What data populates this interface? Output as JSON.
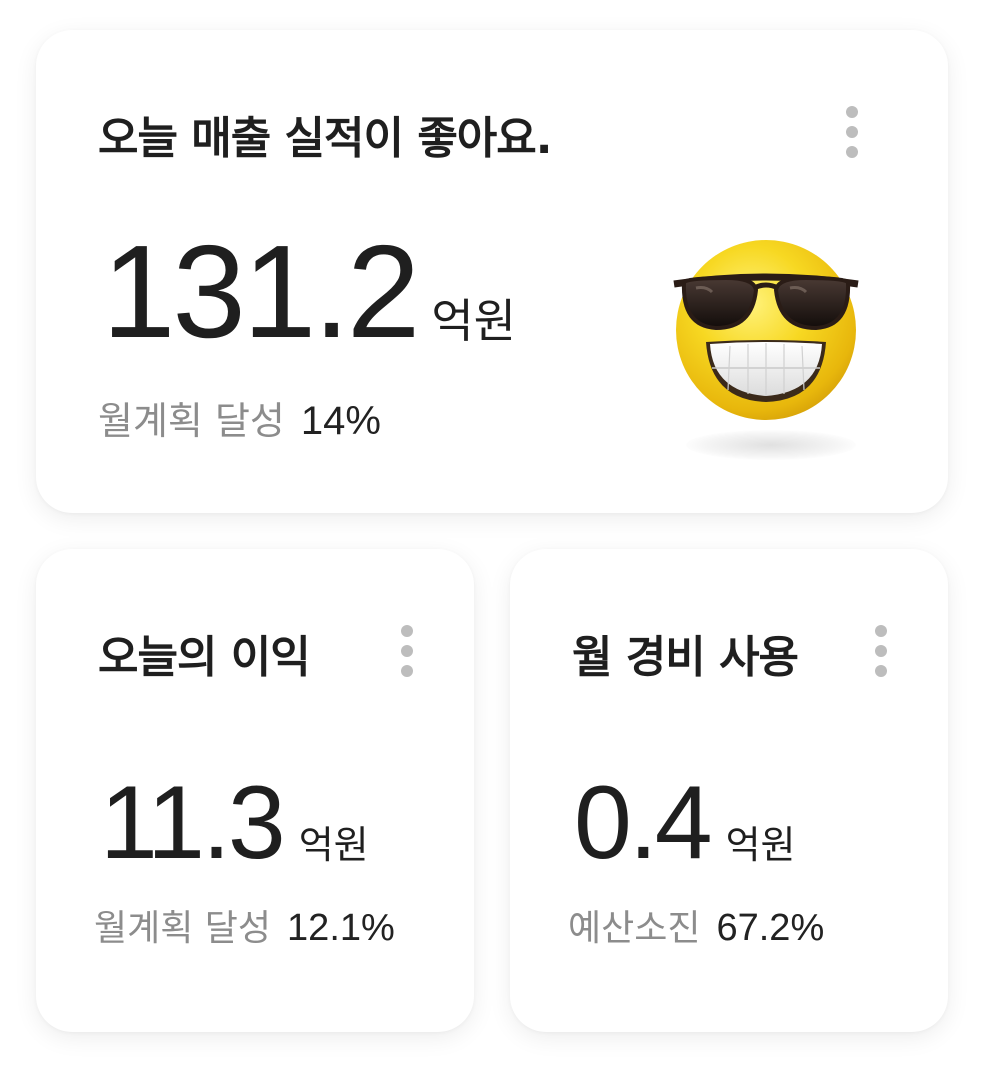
{
  "sales_card": {
    "title": "오늘 매출 실적이 좋아요.",
    "value": "131.2",
    "unit": "억원",
    "sub_label": "월계획 달성",
    "sub_value": "14%",
    "emoji": "sunglasses-smile-emoji"
  },
  "profit_card": {
    "title": "오늘의 이익",
    "value": "11.3",
    "unit": "억원",
    "sub_label": "월계획 달성",
    "sub_value": "12.1%"
  },
  "expense_card": {
    "title": "월 경비 사용",
    "value": "0.4",
    "unit": "억원",
    "sub_label": "예산소진",
    "sub_value": "67.2%"
  },
  "icons": {
    "menu": "more-vertical-icon"
  },
  "colors": {
    "card_bg": "#ffffff",
    "text_primary": "#1f1f1f",
    "text_secondary": "#8c8c8c",
    "kebab_dot": "#bdbdbd",
    "emoji_yellow": "#f5d418"
  }
}
